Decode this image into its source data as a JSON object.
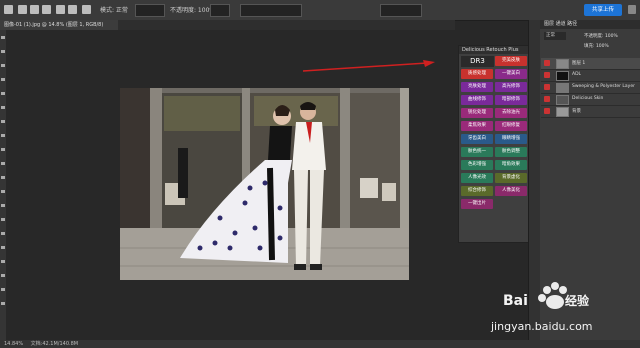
{
  "topbar": {
    "options_text": "模式: 正常",
    "opacity_text": "不透明度: 100%",
    "share_button": "共享上传"
  },
  "document": {
    "tab_title": "图像-01 (1).jpg @ 14.8% (图层 1, RGB/8)"
  },
  "status": {
    "zoom": "14.84%",
    "doc_info": "文档:42.1M/140.8M"
  },
  "retouch_panel": {
    "title": "Delicious Retouch Plus",
    "logo": "DR3",
    "buttons": [
      {
        "label": "完美皮肤",
        "color": "#c8322e"
      },
      {
        "label": "质感处理",
        "color": "#c8322e"
      },
      {
        "label": "一键美白",
        "color": "#8a2a8a"
      },
      {
        "label": "亮肤处理",
        "color": "#7a2a9a"
      },
      {
        "label": "高光修饰",
        "color": "#7a2a9a"
      },
      {
        "label": "曲线修饰",
        "color": "#7a2a9a"
      },
      {
        "label": "暗部修饰",
        "color": "#7a2a9a"
      },
      {
        "label": "锐化处理",
        "color": "#9a2a7a"
      },
      {
        "label": "去除油光",
        "color": "#9a2a7a"
      },
      {
        "label": "柔焦效果",
        "color": "#9a2a7a"
      },
      {
        "label": "红眼修复",
        "color": "#9a2a7a"
      },
      {
        "label": "牙齿美白",
        "color": "#2a5a8a"
      },
      {
        "label": "眼睛增强",
        "color": "#2a5a8a"
      },
      {
        "label": "肤色统一",
        "color": "#2a7a5a"
      },
      {
        "label": "肤色调整",
        "color": "#2a7a5a"
      },
      {
        "label": "色彩增强",
        "color": "#2a7a5a"
      },
      {
        "label": "暗角效果",
        "color": "#2a7a5a"
      },
      {
        "label": "人像光效",
        "color": "#2a7a5a"
      },
      {
        "label": "背景虚化",
        "color": "#5a6a2a"
      },
      {
        "label": "综合修饰",
        "color": "#5a6a2a"
      },
      {
        "label": "人像美化",
        "color": "#8a2a6a"
      },
      {
        "label": "一键出片",
        "color": "#8a2a6a"
      }
    ]
  },
  "layers_panel": {
    "tabs": "图层 通道 路径",
    "blend_mode": "正常",
    "opacity": "不透明度: 100%",
    "fill": "填充: 100%",
    "layers": [
      {
        "name": "图层 1",
        "thumb": "#888888",
        "selected": true
      },
      {
        "name": "ADL",
        "thumb": "#111111",
        "selected": false
      },
      {
        "name": "Sweeping & Polyester Layer",
        "thumb": "#777777",
        "selected": false
      },
      {
        "name": "Delicious Skin",
        "thumb": "#555555",
        "selected": false
      },
      {
        "name": "背景",
        "thumb": "#999999",
        "selected": false
      }
    ]
  },
  "watermark": {
    "brand": "Bai",
    "brand2": "经验",
    "url": "jingyan.baidu.com"
  },
  "colors": {
    "accent_red": "#d02020",
    "share_blue": "#1d74d6"
  }
}
